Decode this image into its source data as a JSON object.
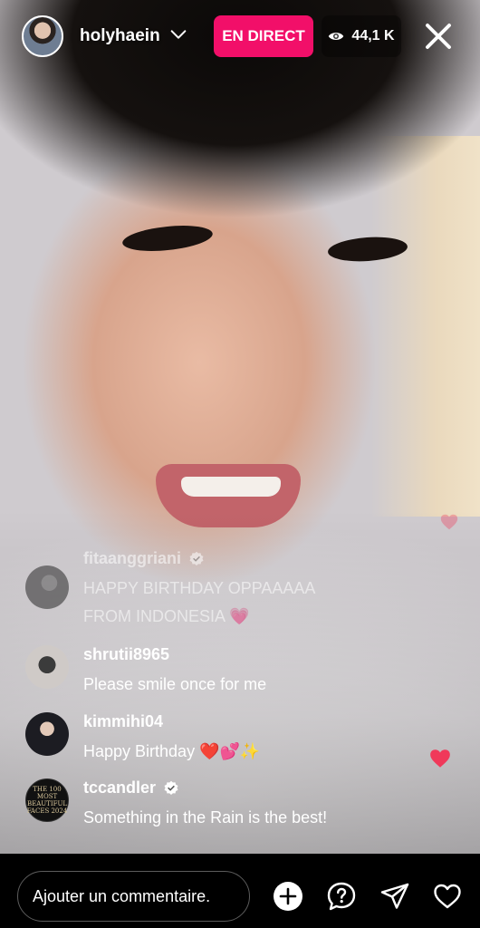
{
  "header": {
    "username": "holyhaein",
    "live_label": "EN DIRECT",
    "viewer_count": "44,1 K"
  },
  "comments": [
    {
      "username": "fitaanggriani",
      "verified": true,
      "text": "HAPPY BIRTHDAY OPPAAAAA FROM INDONESIA 💗",
      "faded": true
    },
    {
      "username": "shrutii8965",
      "verified": false,
      "text": "Please smile once for me"
    },
    {
      "username": "kimmihi04",
      "verified": false,
      "text": "Happy Birthday ❤️💕✨"
    },
    {
      "username": "tccandler",
      "verified": true,
      "text": "Something in the Rain is the best!",
      "avatar_text": "THE 100 MOST BEAUTIFUL FACES 2024"
    }
  ],
  "footer": {
    "comment_placeholder": "Ajouter un commentaire."
  },
  "colors": {
    "live_badge": "#f20f69",
    "heart": "#f0395a"
  },
  "icons": [
    "chevron-down-icon",
    "eye-icon",
    "close-icon",
    "verified-icon",
    "plus-icon",
    "question-icon",
    "send-icon",
    "heart-icon"
  ]
}
